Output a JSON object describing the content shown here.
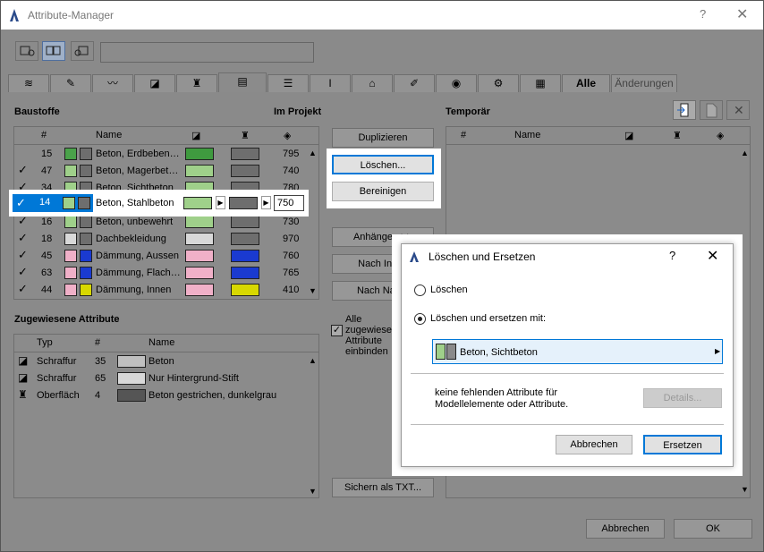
{
  "window": {
    "title": "Attribute-Manager",
    "help": "?",
    "close": "✕"
  },
  "tabs": {
    "alle": "Alle",
    "aenderungen": "Änderungen"
  },
  "left": {
    "title": "Baustoffe",
    "in_project": "Im Projekt",
    "cols": {
      "num": "#",
      "name": "Name"
    },
    "rows": [
      {
        "check": "",
        "num": "15",
        "name": "Beton, Erdbeben…",
        "sw1": "#4aa24a",
        "sw2": "#6e6e6e",
        "pat": "#3f9a3f",
        "val": "795"
      },
      {
        "check": "✓",
        "num": "47",
        "name": "Beton, Magerbet…",
        "sw1": "#9fd08a",
        "sw2": "#6e6e6e",
        "pat": "#9fd08a",
        "val": "740"
      },
      {
        "check": "✓",
        "num": "34",
        "name": "Beton, Sichtbeton",
        "sw1": "#9fd08a",
        "sw2": "#6e6e6e",
        "pat": "#9fd08a",
        "val": "780"
      },
      {
        "check": "✓",
        "num": "14",
        "name": "Beton, Stahlbeton",
        "sw1": "#9fd08a",
        "sw2": "#6e6e6e",
        "pat": "#9fd08a",
        "val": "750",
        "selected": true
      },
      {
        "check": "✓",
        "num": "16",
        "name": "Beton, unbewehrt",
        "sw1": "#9fd08a",
        "sw2": "#6e6e6e",
        "pat": "#9fd08a",
        "val": "730"
      },
      {
        "check": "✓",
        "num": "18",
        "name": "Dachbekleidung",
        "sw1": "#d8d8d8",
        "sw2": "#6e6e6e",
        "pat": "#d8d8d8",
        "val": "970"
      },
      {
        "check": "✓",
        "num": "45",
        "name": "Dämmung, Aussen",
        "sw1": "#f0b0c8",
        "sw2": "#1a3ad0",
        "pat": "#f0b0c8",
        "val": "760"
      },
      {
        "check": "✓",
        "num": "63",
        "name": "Dämmung, Flach…",
        "sw1": "#f0b0c8",
        "sw2": "#1a3ad0",
        "pat": "#f0b0c8",
        "val": "765"
      },
      {
        "check": "✓",
        "num": "44",
        "name": "Dämmung, Innen",
        "sw1": "#f0b0c8",
        "sw2": "#d8d800",
        "pat": "#f0b0c8",
        "val": "410"
      }
    ],
    "assigned_title": "Zugewiesene Attribute",
    "assigned_cols": {
      "typ": "Typ",
      "num": "#",
      "name": "Name"
    },
    "assigned": [
      {
        "typ": "Schraffur",
        "num": "35",
        "name": "Beton",
        "color": "#c0c0c0"
      },
      {
        "typ": "Schraffur",
        "num": "65",
        "name": "Nur Hintergrund-Stift",
        "color": "#d8d8d8"
      },
      {
        "typ": "Oberfläche",
        "num": "4",
        "name": "Beton gestrichen, dunkelgrau",
        "color": "#555555"
      }
    ]
  },
  "middle": {
    "duplizieren": "Duplizieren",
    "loeschen": "Löschen...",
    "bereinigen": "Bereinigen",
    "anhaengen": "Anhängen >>",
    "nach_index": "Nach Index",
    "nach_name": "Nach Name",
    "alle_zugewiesenen": "Alle zugewiesenen Attribute einbinden",
    "sichern": "Sichern als TXT..."
  },
  "right": {
    "title": "Temporär",
    "cols": {
      "num": "#",
      "name": "Name"
    }
  },
  "footer": {
    "abbrechen": "Abbrechen",
    "ok": "OK"
  },
  "dialog": {
    "title": "Löschen und Ersetzen",
    "help": "?",
    "close": "✕",
    "opt1": "Löschen",
    "opt2": "Löschen und ersetzen mit:",
    "selected": "Beton, Sichtbeton",
    "info": "keine fehlenden Attribute für Modellelemente oder Attribute.",
    "details": "Details...",
    "abbrechen": "Abbrechen",
    "ersetzen": "Ersetzen"
  }
}
